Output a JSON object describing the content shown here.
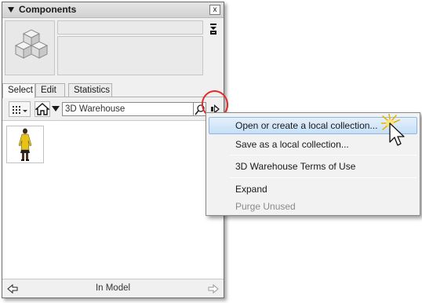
{
  "panel": {
    "title": "Components",
    "close_glyph": "x"
  },
  "tabs": [
    {
      "label": "Select"
    },
    {
      "label": "Edit"
    },
    {
      "label": "Statistics"
    }
  ],
  "search": {
    "value": "3D Warehouse"
  },
  "status": {
    "text": "In Model"
  },
  "menu": {
    "items": [
      {
        "label": "Open or create a local collection..."
      },
      {
        "label": "Save as a local collection..."
      },
      {
        "label": "3D Warehouse Terms of Use"
      },
      {
        "label": "Expand"
      },
      {
        "label": "Purge Unused"
      }
    ]
  },
  "icons": {
    "collapse": "triangle-down-icon",
    "close": "close-icon",
    "preview": "component-cubes-icon",
    "view_options": "grid-view-icon",
    "home": "home-icon",
    "navigation": "dropdown-arrow-icon",
    "search": "search-icon",
    "details": "details-arrow-icon",
    "back": "back-arrow-icon",
    "forward": "forward-arrow-icon"
  },
  "colors": {
    "highlight_ring": "#e32b2b",
    "menu_highlight": "#c6dff7"
  }
}
